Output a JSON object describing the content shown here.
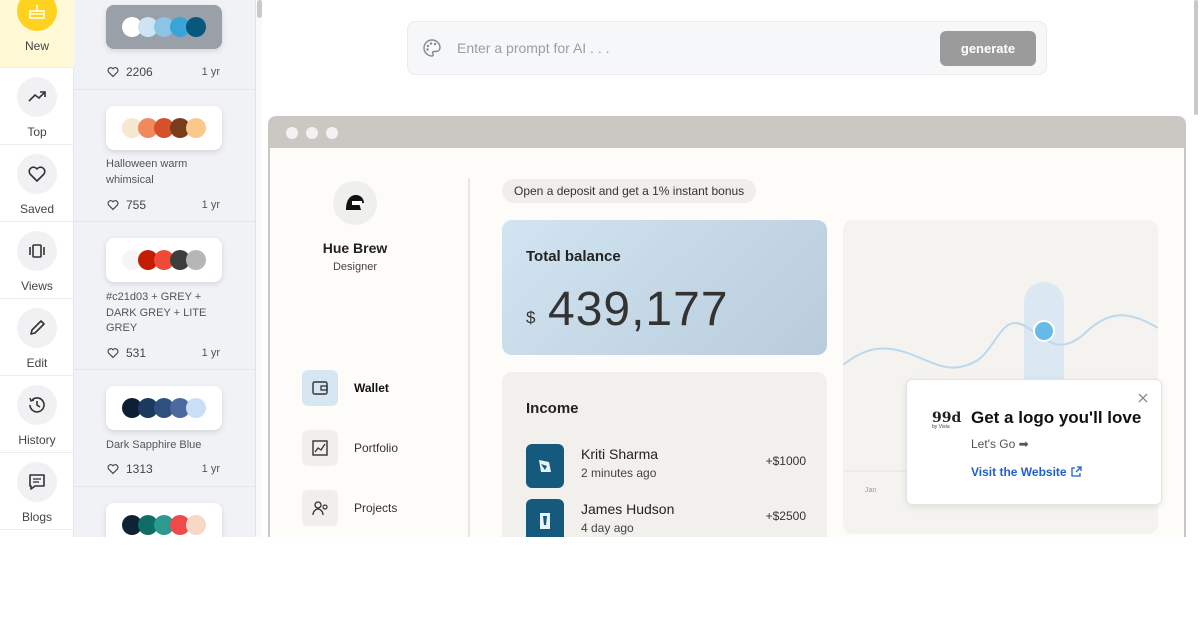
{
  "nav": [
    {
      "label": "New",
      "icon": "cake-icon",
      "active": true
    },
    {
      "label": "Top",
      "icon": "trending-up-icon"
    },
    {
      "label": "Saved",
      "icon": "heart-icon"
    },
    {
      "label": "Views",
      "icon": "views-icon"
    },
    {
      "label": "Edit",
      "icon": "pencil-icon"
    },
    {
      "label": "History",
      "icon": "history-icon"
    },
    {
      "label": "Blogs",
      "icon": "message-icon"
    }
  ],
  "palettes": [
    {
      "name": "",
      "colors": [
        "#ffffff",
        "#cde4f2",
        "#8cc4e6",
        "#3aa3d8",
        "#08577d"
      ],
      "likes": "2206",
      "age": "1 yr"
    },
    {
      "name": "Halloween warm whimsical",
      "colors": [
        "#f6e7cf",
        "#f08a5d",
        "#d7502c",
        "#7a3d1c",
        "#f8c98a"
      ],
      "likes": "755",
      "age": "1 yr"
    },
    {
      "name": "#c21d03 + GREY + DARK GREY + LITE GREY",
      "colors": [
        "#f5f5f5",
        "#c21d03",
        "#ef4a37",
        "#3e3e3e",
        "#b6b6b6"
      ],
      "likes": "531",
      "age": "1 yr"
    },
    {
      "name": "Dark Sapphire Blue",
      "colors": [
        "#0c1e34",
        "#1c3a5e",
        "#2f4f7f",
        "#4d6a9e",
        "#c9dff7"
      ],
      "likes": "1313",
      "age": "1 yr"
    },
    {
      "name": "",
      "colors": [
        "#0f2337",
        "#0f6c66",
        "#2d9a8f",
        "#ef4a4a",
        "#f8d8c4"
      ],
      "likes": "",
      "age": ""
    }
  ],
  "prompt": {
    "placeholder": "Enter a prompt for AI . . .",
    "button": "generate"
  },
  "preview": {
    "profile": {
      "name": "Hue Brew",
      "role": "Designer"
    },
    "menu": [
      {
        "label": "Wallet",
        "active": true
      },
      {
        "label": "Portfolio"
      },
      {
        "label": "Projects"
      }
    ],
    "promo": "Open a deposit and get a 1% instant bonus",
    "balance": {
      "title": "Total balance",
      "currency": "$",
      "amount": "439,177"
    },
    "income": {
      "title": "Income",
      "rows": [
        {
          "name": "Kriti Sharma",
          "time": "2 minutes ago",
          "amount": "+$1000"
        },
        {
          "name": "James Hudson",
          "time": "4 day ago",
          "amount": "+$2500"
        }
      ]
    },
    "chart": {
      "month_label": "Jan"
    }
  },
  "ad": {
    "logo": "99d",
    "logo_sub": "by Vista",
    "headline": "Get a logo you'll love",
    "sub": "Let's Go ➡",
    "link": "Visit the Website"
  }
}
